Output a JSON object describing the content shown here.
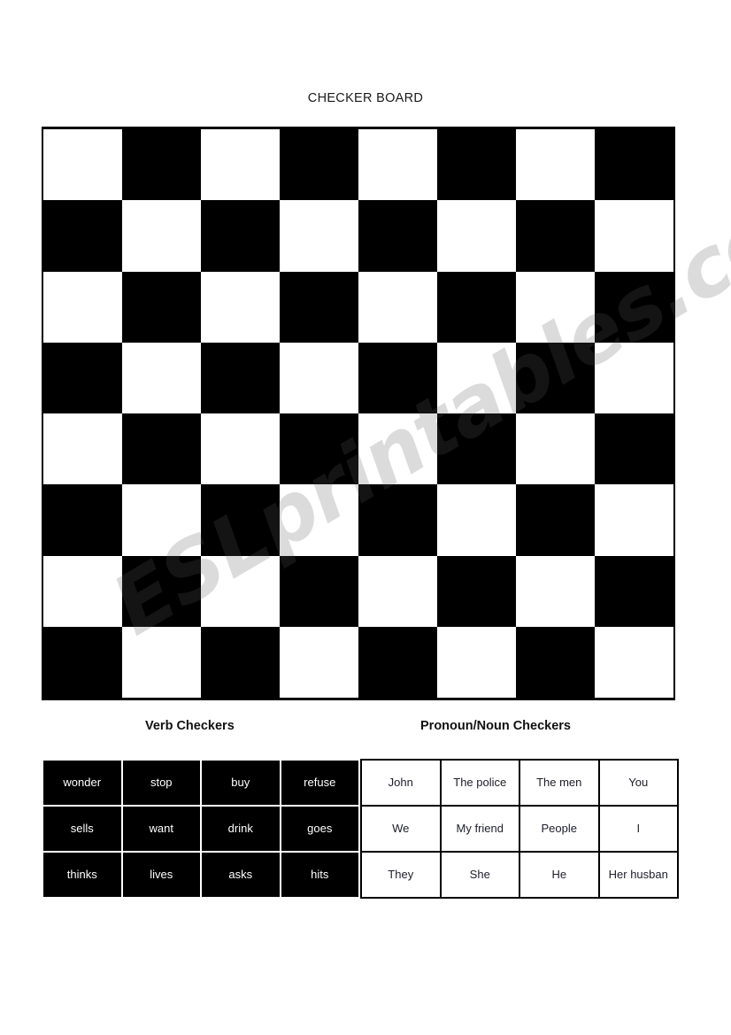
{
  "page": {
    "title": "CHECKER BOARD",
    "watermark": "ESLprintables.com",
    "background_color": "#ffffff"
  },
  "board": {
    "name": "checker-board",
    "rows": 8,
    "columns": 8,
    "light_color": "#ffffff",
    "dark_color": "#000000",
    "top_left_square": "light",
    "border_color": "#000000"
  },
  "sections": {
    "verb": {
      "label": "Verb Checkers",
      "text_color": "#ffffff",
      "cell_color": "#000000",
      "rows": [
        [
          "wonder",
          "stop",
          "buy",
          "refuse"
        ],
        [
          "sells",
          "want",
          "drink",
          "goes"
        ],
        [
          "thinks",
          "lives",
          "asks",
          "hits"
        ]
      ]
    },
    "pronoun_noun": {
      "label": "Pronoun/Noun Checkers",
      "text_color": "#20202e",
      "cell_color": "#ffffff",
      "rows": [
        [
          "John",
          "The police",
          "The men",
          "You"
        ],
        [
          "We",
          "My friend",
          "People",
          "I"
        ],
        [
          "They",
          "She",
          "He",
          "Her husban"
        ]
      ]
    }
  }
}
